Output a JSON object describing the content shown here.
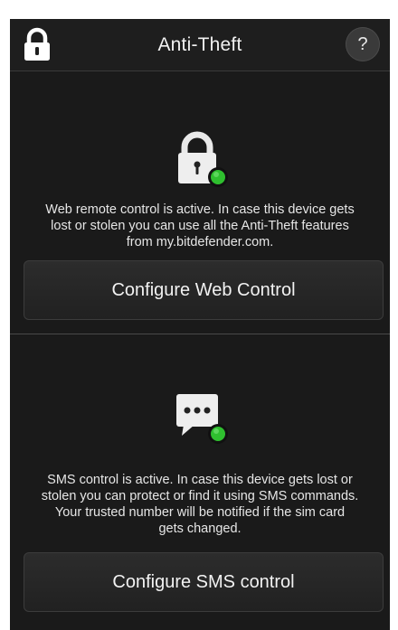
{
  "header": {
    "title": "Anti-Theft",
    "help_label": "?",
    "app_icon": "padlock-icon"
  },
  "web_control": {
    "icon": "lock-with-green-status-icon",
    "description": "Web remote control is active. In case this device gets\nlost or stolen you can use all the Anti-Theft features\nfrom my.bitdefender.com.",
    "button_label": "Configure Web Control"
  },
  "sms_control": {
    "icon": "sms-bubble-with-green-status-icon",
    "description": "SMS control is active. In case this device gets lost or\nstolen you can protect or find it using SMS commands.\nYour trusted number will be notified if the sim card\ngets changed.",
    "button_label": "Configure SMS control"
  },
  "colors": {
    "background": "#1a1a1a",
    "status_green": "#2fbf2f",
    "text": "#e6e6e6"
  }
}
